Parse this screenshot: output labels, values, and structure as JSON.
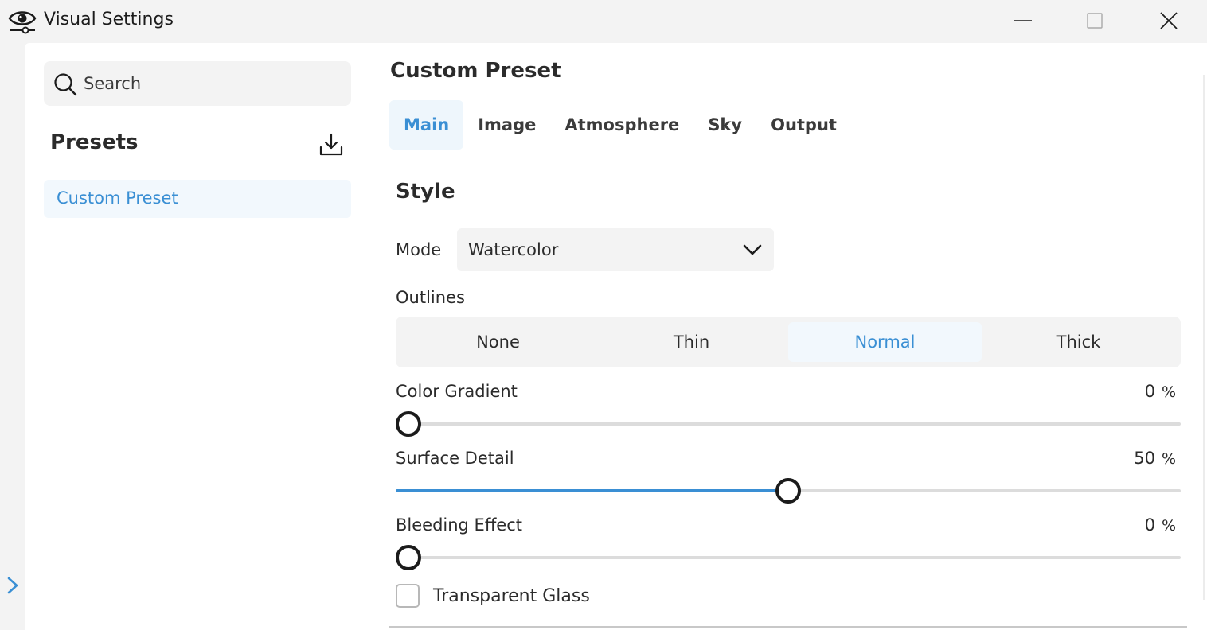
{
  "window": {
    "title": "Visual Settings",
    "icon": "eye-settings-icon",
    "controls": [
      "minimize-icon",
      "maximize-icon",
      "close-icon"
    ]
  },
  "sidebar": {
    "search": {
      "placeholder": "Search",
      "value": ""
    },
    "presets_title": "Presets",
    "download_icon": "download-icon",
    "items": [
      {
        "label": "Custom Preset",
        "selected": true
      }
    ]
  },
  "main": {
    "title": "Custom Preset",
    "tabs": [
      {
        "label": "Main",
        "active": true
      },
      {
        "label": "Image",
        "active": false
      },
      {
        "label": "Atmosphere",
        "active": false
      },
      {
        "label": "Sky",
        "active": false
      },
      {
        "label": "Output",
        "active": false
      }
    ],
    "section_title": "Style",
    "mode": {
      "label": "Mode",
      "value": "Watercolor"
    },
    "outlines": {
      "label": "Outlines",
      "options": [
        "None",
        "Thin",
        "Normal",
        "Thick"
      ],
      "selected": "Normal"
    },
    "sliders": [
      {
        "label": "Color Gradient",
        "value": "0",
        "unit": "%",
        "fraction": 0.0
      },
      {
        "label": "Surface Detail",
        "value": "50",
        "unit": "%",
        "fraction": 0.5
      },
      {
        "label": "Bleeding Effect",
        "value": "0",
        "unit": "%",
        "fraction": 0.0
      }
    ],
    "checkbox": {
      "label": "Transparent Glass",
      "checked": false
    }
  },
  "colors": {
    "accent": "#3a8fd4",
    "selected_bg": "#f2f8fd",
    "surface": "#f3f3f3",
    "text": "#2b2b2b"
  }
}
